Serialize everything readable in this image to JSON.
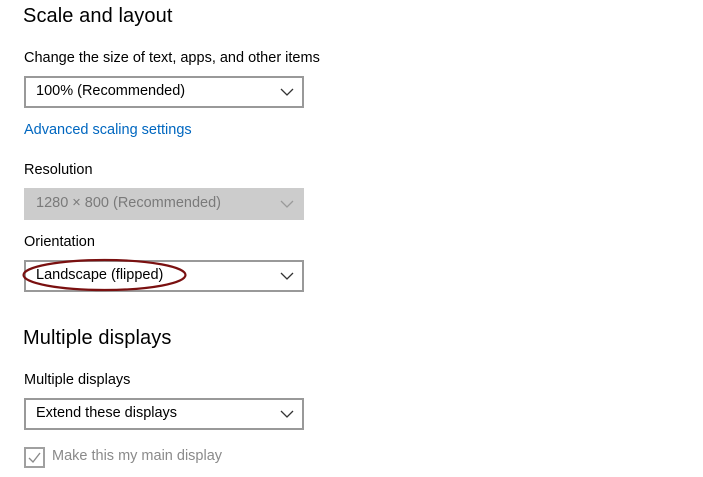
{
  "scale_section": {
    "title": "Scale and layout",
    "scale_label": "Change the size of text, apps, and other items",
    "scale_value": "100% (Recommended)",
    "advanced_link": "Advanced scaling settings",
    "resolution_label": "Resolution",
    "resolution_value": "1280 × 800 (Recommended)",
    "orientation_label": "Orientation",
    "orientation_value": "Landscape (flipped)"
  },
  "multiple_section": {
    "title": "Multiple displays",
    "displays_label": "Multiple displays",
    "displays_value": "Extend these displays",
    "main_display_label": "Make this my main display",
    "main_display_checked": true,
    "main_display_disabled": true
  },
  "colors": {
    "link": "#0067c0",
    "dropdown_border": "#999999",
    "disabled_fill": "#cccccc",
    "annotation": "#7a1010"
  },
  "icons": {
    "dropdown_chevron": "chevron-down-icon",
    "checkbox_check": "checkmark-icon"
  }
}
